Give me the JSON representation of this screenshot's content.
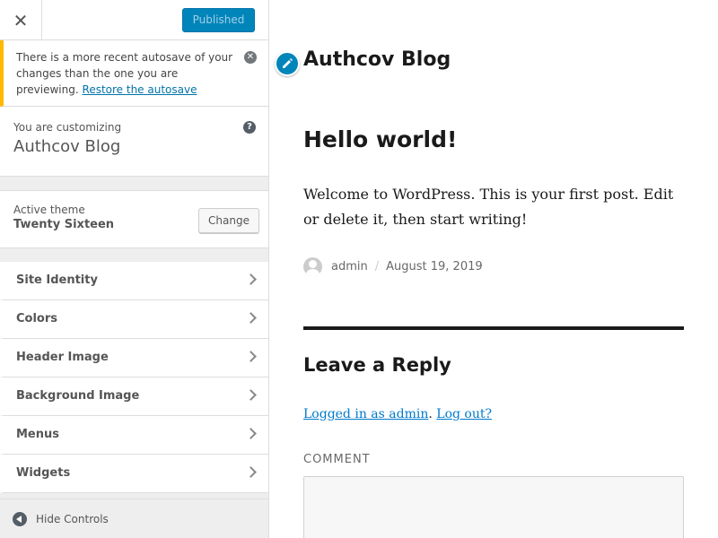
{
  "sidebar": {
    "close_icon": "close-icon",
    "publish_label": "Published",
    "colors": {
      "accent": "#0085ba",
      "notice": "#ffb900"
    },
    "notice": {
      "text": "There is a more recent autosave of your changes than the one you are previewing.",
      "link": "Restore the autosave",
      "dismiss_icon": "dismiss-icon"
    },
    "customizing": {
      "label": "You are customizing",
      "site_name": "Authcov Blog",
      "help_icon": "help-icon"
    },
    "theme": {
      "label": "Active theme",
      "name": "Twenty Sixteen",
      "change_label": "Change"
    },
    "sections": [
      "Site Identity",
      "Colors",
      "Header Image",
      "Background Image",
      "Menus",
      "Widgets"
    ],
    "footer": {
      "hide_label": "Hide Controls",
      "icon": "collapse-icon"
    }
  },
  "preview": {
    "site_title": "Authcov Blog",
    "edit_icon": "pencil-icon",
    "post": {
      "title": "Hello world!",
      "content": "Welcome to WordPress. This is your first post. Edit or delete it, then start writing!",
      "author": "admin",
      "separator": "/",
      "date": "August 19, 2019"
    },
    "reply": {
      "title": "Leave a Reply",
      "logged_in_link": "Logged in as admin",
      "period": ".",
      "logout_link": "Log out?",
      "comment_label": "COMMENT"
    }
  }
}
